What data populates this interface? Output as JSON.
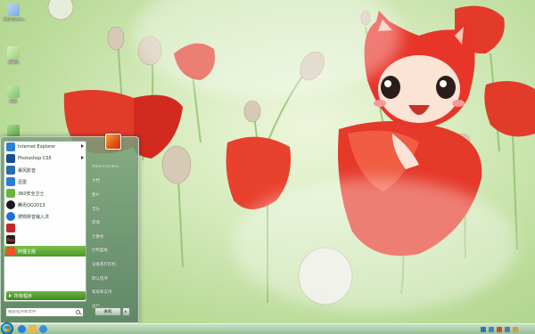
{
  "desktop": {
    "icons": [
      {
        "label": "Administra...",
        "icon": "computer-icon",
        "color": "#7aa9d9"
      },
      {
        "label": "计算机",
        "icon": "recycle-bin-icon",
        "color": "#9ad07a"
      },
      {
        "label": "网络",
        "icon": "network-icon",
        "color": "#7ac06a"
      },
      {
        "label": "回收站",
        "icon": "trash-icon",
        "color": "#5aa14a"
      }
    ]
  },
  "start_menu": {
    "programs": [
      {
        "label": "Internet Explorer",
        "icon": "ie-icon",
        "color": "#2f7fd1",
        "has_arrow": true
      },
      {
        "label": "Photoshop CS5",
        "icon": "photoshop-icon",
        "color": "#1b4e8f",
        "has_arrow": true
      },
      {
        "label": "暴风影音",
        "icon": "media-player-icon",
        "color": "#2b6bb0",
        "has_arrow": false
      },
      {
        "label": "迅雷",
        "icon": "thunder-icon",
        "color": "#2b7cd3",
        "has_arrow": false
      },
      {
        "label": "360安全卫士",
        "icon": "shield-icon",
        "color": "#6bb63a",
        "has_arrow": false
      },
      {
        "label": "腾讯QQ2013",
        "icon": "qq-icon",
        "color": "#1a1a1a",
        "has_arrow": false
      },
      {
        "label": "搜狗拼音输入法",
        "icon": "sogou-icon",
        "color": "#1e6fd9",
        "has_arrow": false
      },
      {
        "label": "",
        "icon": "app-icon",
        "color": "#c32a2a",
        "has_arrow": false
      },
      {
        "label": "Res",
        "icon": "res-icon",
        "color": "#222222",
        "has_arrow": false
      },
      {
        "label": "阿狸主题",
        "icon": "ali-theme-icon",
        "color": "#e8552b",
        "has_arrow": false,
        "highlight": true
      }
    ],
    "all_programs_label": "所有程序",
    "search": {
      "placeholder": "搜索程序和文件"
    },
    "user_name": "Administrator",
    "right_items": [
      "文档",
      "图片",
      "音乐",
      "游戏",
      "计算机",
      "控制面板",
      "设备和打印机",
      "默认程序",
      "帮助和支持",
      "运行..."
    ],
    "shutdown_label": "关机"
  },
  "taskbar": {
    "quick_launch": [
      {
        "icon": "ie-taskbar-icon",
        "color": "#2f7fd1"
      },
      {
        "icon": "explorer-taskbar-icon",
        "color": "#e9b949"
      },
      {
        "icon": "media-taskbar-icon",
        "color": "#3a8fd6"
      }
    ],
    "tray": [
      {
        "icon": "language-icon",
        "color": "#3a6fb0"
      },
      {
        "icon": "network-tray-icon",
        "color": "#4a7fc0"
      },
      {
        "icon": "security-tray-icon",
        "color": "#d04b2a"
      },
      {
        "icon": "volume-icon",
        "color": "#5a7aa0"
      },
      {
        "icon": "flag-tray-icon",
        "color": "#c8a43a"
      }
    ],
    "clock": "19:05"
  }
}
